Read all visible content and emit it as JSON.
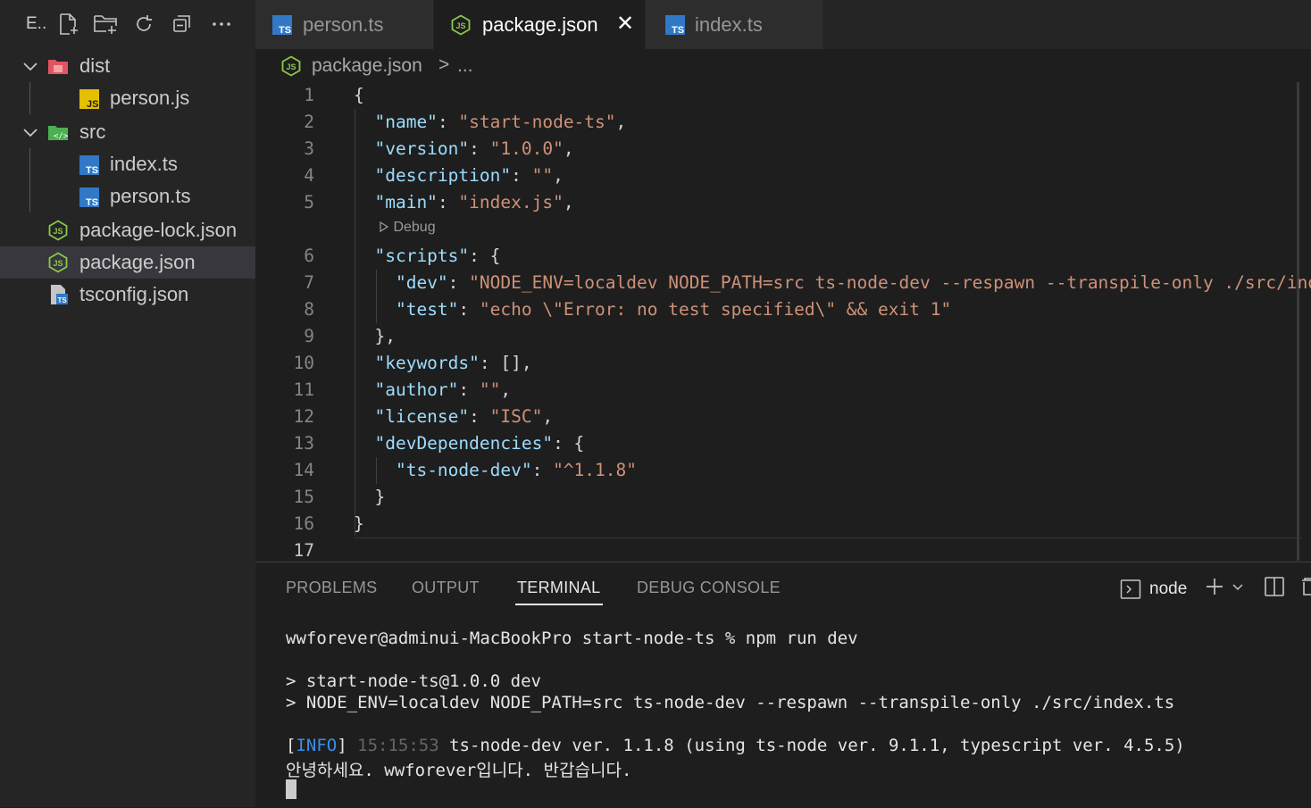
{
  "colors": {
    "ts_blue": "#3178c6",
    "js_yellow": "#e5c000",
    "node_green": "#8cc84b",
    "dist_red": "#e05561",
    "src_green": "#4caf50",
    "accent": "#e7e7e7"
  },
  "explorer": {
    "title": "E..",
    "toolbar_icons": [
      "new-file-icon",
      "new-folder-icon",
      "refresh-icon",
      "collapse-all-icon",
      "more-icon"
    ],
    "tree": [
      {
        "label": "dist",
        "type": "folder",
        "expanded": true,
        "icon": "folder-dist-icon"
      },
      {
        "label": "person.js",
        "type": "file",
        "icon": "js-file-icon"
      },
      {
        "label": "src",
        "type": "folder",
        "expanded": true,
        "icon": "folder-src-icon"
      },
      {
        "label": "index.ts",
        "type": "file",
        "icon": "ts-file-icon"
      },
      {
        "label": "person.ts",
        "type": "file",
        "icon": "ts-file-icon"
      },
      {
        "label": "package-lock.json",
        "type": "file",
        "icon": "nodejs-icon"
      },
      {
        "label": "package.json",
        "type": "file",
        "icon": "nodejs-icon",
        "selected": true
      },
      {
        "label": "tsconfig.json",
        "type": "file",
        "icon": "tsconfig-icon"
      }
    ]
  },
  "tabs": [
    {
      "label": "person.ts",
      "icon": "ts-file-icon"
    },
    {
      "label": "package.json",
      "icon": "nodejs-icon",
      "active": true,
      "close": "✕"
    },
    {
      "label": "index.ts",
      "icon": "ts-file-icon"
    }
  ],
  "breadcrumb": {
    "file": "package.json",
    "separator": ">",
    "more": "..."
  },
  "editor": {
    "codelens": "Debug",
    "lines": [
      {
        "n": "1",
        "tokens": [
          [
            "p",
            "{"
          ]
        ]
      },
      {
        "n": "2",
        "tokens": [
          [
            "p",
            "  "
          ],
          [
            "k",
            "\"name\""
          ],
          [
            "p",
            ": "
          ],
          [
            "s",
            "\"start-node-ts\""
          ],
          [
            "p",
            ","
          ]
        ]
      },
      {
        "n": "3",
        "tokens": [
          [
            "p",
            "  "
          ],
          [
            "k",
            "\"version\""
          ],
          [
            "p",
            ": "
          ],
          [
            "s",
            "\"1.0.0\""
          ],
          [
            "p",
            ","
          ]
        ]
      },
      {
        "n": "4",
        "tokens": [
          [
            "p",
            "  "
          ],
          [
            "k",
            "\"description\""
          ],
          [
            "p",
            ": "
          ],
          [
            "s",
            "\"\""
          ],
          [
            "p",
            ","
          ]
        ]
      },
      {
        "n": "5",
        "tokens": [
          [
            "p",
            "  "
          ],
          [
            "k",
            "\"main\""
          ],
          [
            "p",
            ": "
          ],
          [
            "s",
            "\"index.js\""
          ],
          [
            "p",
            ","
          ]
        ]
      },
      {
        "n": "6",
        "tokens": [
          [
            "p",
            "  "
          ],
          [
            "k",
            "\"scripts\""
          ],
          [
            "p",
            ": {"
          ]
        ]
      },
      {
        "n": "7",
        "tokens": [
          [
            "p",
            "    "
          ],
          [
            "k",
            "\"dev\""
          ],
          [
            "p",
            ": "
          ],
          [
            "s",
            "\"NODE_ENV=localdev NODE_PATH=src ts-node-dev --respawn --transpile-only ./src/index.ts\""
          ],
          [
            "p",
            ","
          ]
        ]
      },
      {
        "n": "8",
        "tokens": [
          [
            "p",
            "    "
          ],
          [
            "k",
            "\"test\""
          ],
          [
            "p",
            ": "
          ],
          [
            "s",
            "\"echo \\\"Error: no test specified\\\" && exit 1\""
          ]
        ]
      },
      {
        "n": "9",
        "tokens": [
          [
            "p",
            "  },"
          ]
        ]
      },
      {
        "n": "10",
        "tokens": [
          [
            "p",
            "  "
          ],
          [
            "k",
            "\"keywords\""
          ],
          [
            "p",
            ": [],"
          ]
        ]
      },
      {
        "n": "11",
        "tokens": [
          [
            "p",
            "  "
          ],
          [
            "k",
            "\"author\""
          ],
          [
            "p",
            ": "
          ],
          [
            "s",
            "\"\""
          ],
          [
            "p",
            ","
          ]
        ]
      },
      {
        "n": "12",
        "tokens": [
          [
            "p",
            "  "
          ],
          [
            "k",
            "\"license\""
          ],
          [
            "p",
            ": "
          ],
          [
            "s",
            "\"ISC\""
          ],
          [
            "p",
            ","
          ]
        ]
      },
      {
        "n": "13",
        "tokens": [
          [
            "p",
            "  "
          ],
          [
            "k",
            "\"devDependencies\""
          ],
          [
            "p",
            ": {"
          ]
        ]
      },
      {
        "n": "14",
        "tokens": [
          [
            "p",
            "    "
          ],
          [
            "k",
            "\"ts-node-dev\""
          ],
          [
            "p",
            ": "
          ],
          [
            "s",
            "\"^1.1.8\""
          ]
        ]
      },
      {
        "n": "15",
        "tokens": [
          [
            "p",
            "  }"
          ]
        ]
      },
      {
        "n": "16",
        "tokens": [
          [
            "p",
            "}"
          ]
        ]
      },
      {
        "n": "17",
        "tokens": [
          [
            "p",
            ""
          ]
        ]
      }
    ]
  },
  "panel": {
    "tabs": [
      "PROBLEMS",
      "OUTPUT",
      "TERMINAL",
      "DEBUG CONSOLE"
    ],
    "active_tab": "TERMINAL",
    "terminal_name": "node",
    "controls": [
      "terminal-icon",
      "plus-icon",
      "chevron-down-icon",
      "split-icon",
      "trash-icon"
    ]
  },
  "terminal": {
    "prompt": "wwforever@adminui-MacBookPro start-node-ts % npm run dev",
    "line1": "> start-node-ts@1.0.0 dev",
    "line2": "> NODE_ENV=localdev NODE_PATH=src ts-node-dev --respawn --transpile-only ./src/index.ts",
    "info_open": "[",
    "info_tag": "INFO",
    "info_close": "]",
    "info_time": "15:15:53",
    "info_msg": "ts-node-dev ver. 1.1.8 (using ts-node ver. 9.1.1, typescript ver. 4.5.5)",
    "output": "안녕하세요. wwforever입니다. 반갑습니다."
  }
}
